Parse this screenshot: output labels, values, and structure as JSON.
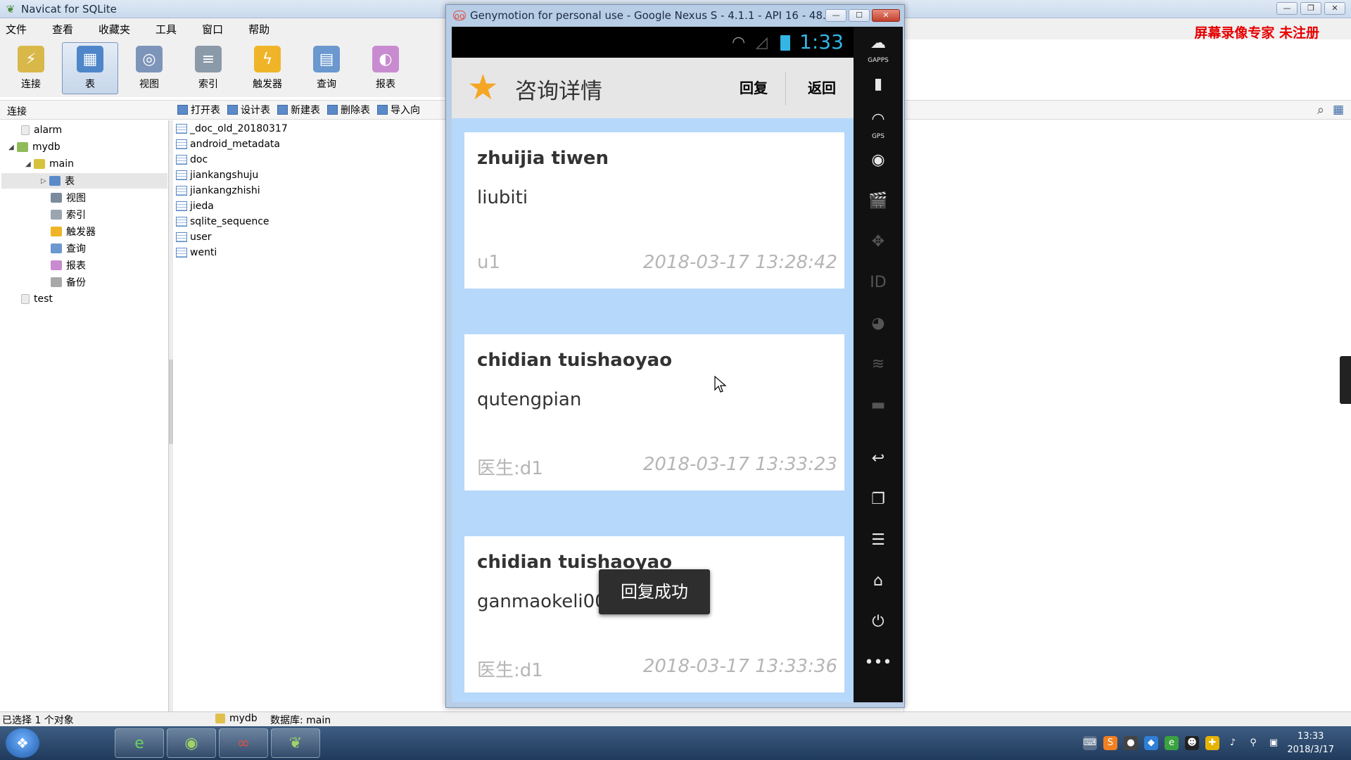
{
  "navicat": {
    "title": "Navicat for SQLite",
    "menu": [
      "文件",
      "查看",
      "收藏夹",
      "工具",
      "窗口",
      "帮助"
    ],
    "toolbar": [
      {
        "label": "连接",
        "color": "#d9b84a",
        "icon": "⚡"
      },
      {
        "label": "表",
        "color": "#4f86c9",
        "icon": "▦"
      },
      {
        "label": "视图",
        "color": "#7d95b8",
        "icon": "◎"
      },
      {
        "label": "索引",
        "color": "#8a9aa8",
        "icon": "≡"
      },
      {
        "label": "触发器",
        "color": "#f0b428",
        "icon": "ϟ"
      },
      {
        "label": "查询",
        "color": "#6a98cf",
        "icon": "▤"
      },
      {
        "label": "报表",
        "color": "#c98bd0",
        "icon": "◐"
      }
    ],
    "connection_header": "连接",
    "object_toolbar": [
      "打开表",
      "设计表",
      "新建表",
      "删除表",
      "导入向"
    ],
    "tree": [
      {
        "label": "alarm",
        "level": 0
      },
      {
        "label": "mydb",
        "level": 0
      },
      {
        "label": "main",
        "level": 1
      },
      {
        "label": "表",
        "level": 2
      },
      {
        "label": "视图",
        "level": 2
      },
      {
        "label": "索引",
        "level": 2
      },
      {
        "label": "触发器",
        "level": 2
      },
      {
        "label": "查询",
        "level": 2
      },
      {
        "label": "报表",
        "level": 2
      },
      {
        "label": "备份",
        "level": 2
      },
      {
        "label": "test",
        "level": 0
      }
    ],
    "tables": [
      "_doc_old_20180317",
      "android_metadata",
      "doc",
      "jiankangshuju",
      "jiankangzhishi",
      "jieda",
      "sqlite_sequence",
      "user",
      "wenti"
    ],
    "status": {
      "selected": "已选择 1 个对象",
      "connection": "mydb",
      "database": "数据库: main"
    },
    "watermark": "屏幕录像专家 未注册"
  },
  "genymotion": {
    "title": "Genymotion for personal use - Google Nexus S - 4.1.1 - API 16 - 48...",
    "android_clock": "1:33",
    "screen_title": "咨询详情",
    "reply_label": "回复",
    "back_label": "返回",
    "cards": [
      {
        "title": "zhuijia tiwen",
        "content": "liubiti",
        "author": "u1",
        "time": "2018-03-17 13:28:42"
      },
      {
        "title": "chidian tuishaoyao",
        "content": "qutengpian",
        "author": "医生:d1",
        "time": "2018-03-17 13:33:23"
      },
      {
        "title": "chidian tuishaoyao",
        "content": "ganmaokeli001",
        "author": "医生:d1",
        "time": "2018-03-17 13:33:36"
      }
    ],
    "toast": "回复成功",
    "sidebar": {
      "gapps": "GAPPS",
      "gps": "GPS",
      "id": "ID"
    }
  },
  "taskbar": {
    "clock_time": "13:33",
    "clock_date": "2018/3/17"
  }
}
